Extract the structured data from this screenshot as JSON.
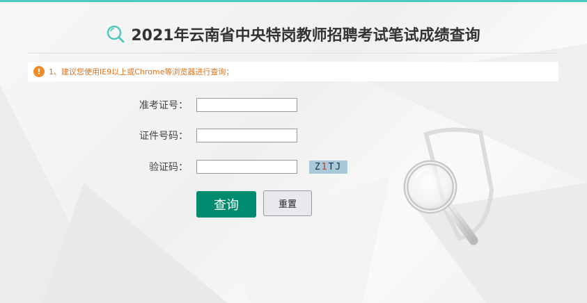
{
  "header": {
    "title": "2021年云南省中央特岗教师招聘考试笔试成绩查询"
  },
  "notice": {
    "text": "1、建议您使用IE9以上或Chrome等浏览器进行查询；"
  },
  "form": {
    "exam_id_label": "准考证号：",
    "id_number_label": "证件号码：",
    "captcha_label": "验证码：",
    "exam_id_value": "",
    "id_number_value": "",
    "captcha_value": ""
  },
  "captcha": {
    "char1": "Z",
    "char2": "1",
    "char3": "T",
    "char4": "J"
  },
  "buttons": {
    "query_label": "查询",
    "reset_label": "重置"
  },
  "colors": {
    "accent": "#4fc8c0",
    "primary_button": "#008a6e",
    "notice_text": "#e0721a"
  }
}
